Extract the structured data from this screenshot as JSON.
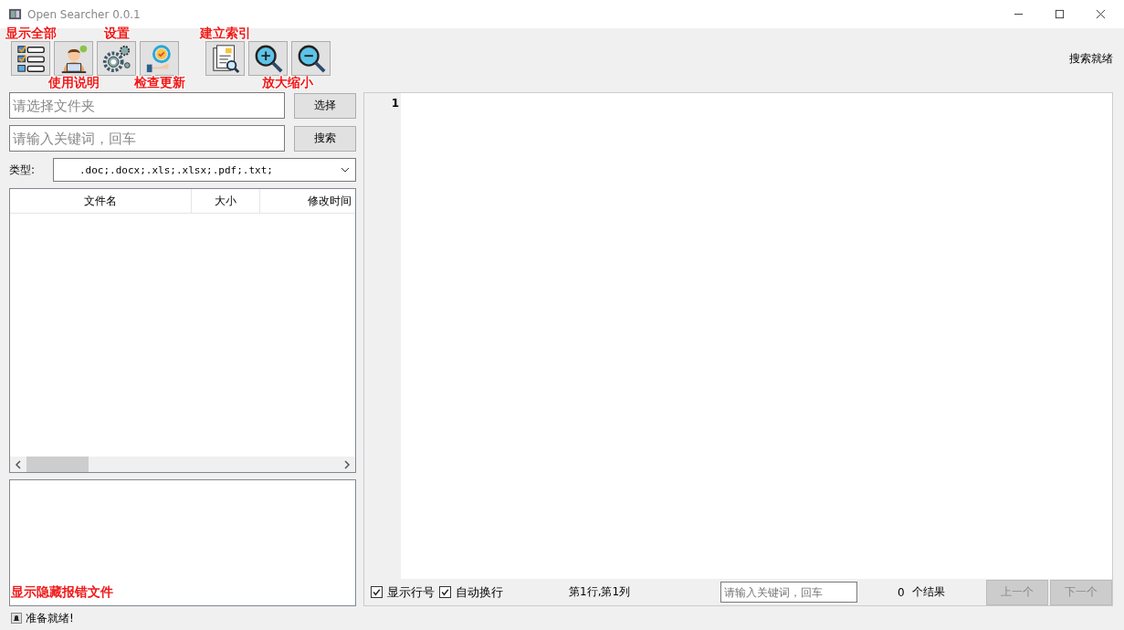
{
  "window": {
    "title": "Open Searcher 0.0.1"
  },
  "toolbar": [
    {
      "kind": "list",
      "annotation": "显示全部",
      "annotation_above": true
    },
    {
      "kind": "person",
      "annotation": "使用说明",
      "annotation_above": false
    },
    {
      "kind": "gears",
      "annotation": "设置",
      "annotation_above": true
    },
    {
      "kind": "update",
      "annotation": "检查更新",
      "annotation_above": false
    },
    {
      "kind": "index",
      "annotation": "建立索引",
      "annotation_above": true
    },
    {
      "kind": "zoom_in",
      "annotation": "放大缩小",
      "annotation_above": false
    },
    {
      "kind": "zoom_out"
    }
  ],
  "toolbar_status": "搜索就绪",
  "folder_field": {
    "placeholder": "请选择文件夹"
  },
  "choose_button": "选择",
  "keyword_field": {
    "placeholder": "请输入关键词，回车"
  },
  "search_button": "搜索",
  "type_label": "类型:",
  "type_value": ".doc;.docx;.xls;.xlsx;.pdf;.txt;",
  "table": {
    "columns": [
      "文件名",
      "大小",
      "修改时间"
    ]
  },
  "log_annotation": "显示隐藏报错文件",
  "status_bar": "准备就绪!",
  "editor": {
    "line_numbers": [
      "1"
    ]
  },
  "editor_footer": {
    "checkboxes": [
      {
        "label": "显示行号",
        "checked": true
      },
      {
        "label": "自动换行",
        "checked": true
      }
    ],
    "position": "第1行,第1列",
    "find_field": {
      "placeholder": "请输入关键词，回车"
    },
    "result_count": "0",
    "result_label": "个结果",
    "buttons": [
      {
        "label": "上一个",
        "disabled": true
      },
      {
        "label": "下一个",
        "disabled": true
      }
    ]
  }
}
